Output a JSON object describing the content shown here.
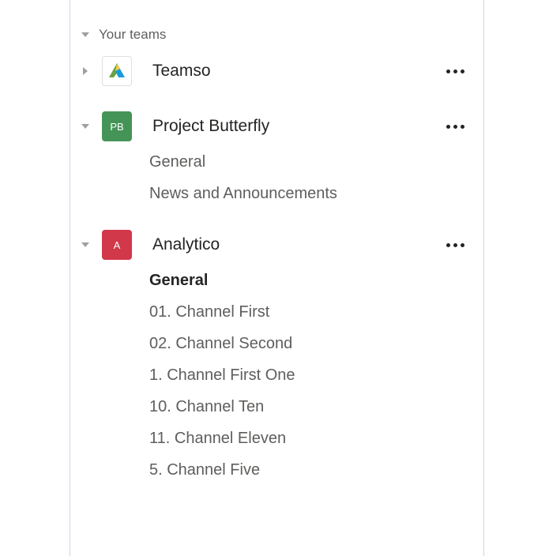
{
  "section": {
    "label": "Your teams"
  },
  "teams": [
    {
      "name": "Teamso",
      "expanded": false,
      "avatar_type": "logo",
      "channels": []
    },
    {
      "name": "Project Butterfly",
      "expanded": true,
      "avatar_type": "initials",
      "avatar_text": "PB",
      "avatar_color": "green",
      "channels": [
        {
          "label": "General",
          "selected": false
        },
        {
          "label": "News and Announcements",
          "selected": false
        }
      ]
    },
    {
      "name": "Analytico",
      "expanded": true,
      "avatar_type": "initials",
      "avatar_text": "A",
      "avatar_color": "red",
      "channels": [
        {
          "label": "General",
          "selected": true
        },
        {
          "label": "01. Channel First",
          "selected": false
        },
        {
          "label": "02. Channel Second",
          "selected": false
        },
        {
          "label": "1. Channel First One",
          "selected": false
        },
        {
          "label": "10. Channel Ten",
          "selected": false
        },
        {
          "label": "11. Channel Eleven",
          "selected": false
        },
        {
          "label": "5. Channel Five",
          "selected": false
        }
      ]
    }
  ]
}
